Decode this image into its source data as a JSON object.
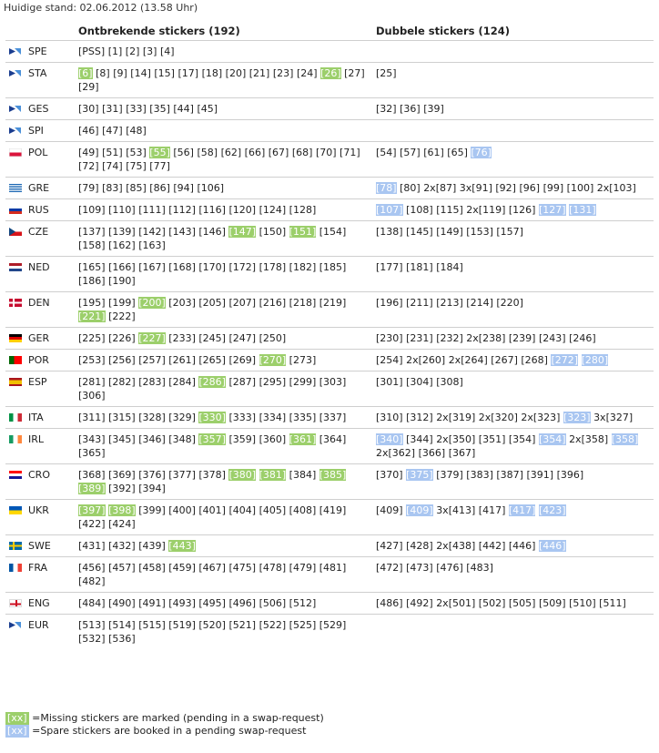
{
  "header": {
    "stand": "Huidige stand: 02.06.2012 (13.58 Uhr)"
  },
  "columns": {
    "missing": "Ontbrekende stickers (192)",
    "double": "Dubbele stickers (124)"
  },
  "flags": {
    "logo": "logo-flag",
    "POL": [
      "#ffffff",
      "#dc143c"
    ],
    "GRE": [
      "#0d5eaf",
      "#ffffff"
    ],
    "RUS": [
      "#ffffff",
      "#0039a6",
      "#d52b1e"
    ],
    "CZE": [
      "#ffffff",
      "#d7141a",
      "#11457e"
    ],
    "NED": [
      "#ae1c28",
      "#ffffff",
      "#21468b"
    ],
    "DEN": [
      "#c60c30",
      "#ffffff"
    ],
    "GER": [
      "#000000",
      "#dd0000",
      "#ffce00"
    ],
    "POR": [
      "#006600",
      "#ff0000"
    ],
    "ESP": [
      "#aa151b",
      "#f1bf00"
    ],
    "ITA": [
      "#009246",
      "#ffffff",
      "#ce2b37"
    ],
    "IRL": [
      "#169b62",
      "#ffffff",
      "#ff883e"
    ],
    "CRO": [
      "#ff0000",
      "#ffffff",
      "#171796"
    ],
    "UKR": [
      "#0057b7",
      "#ffd700"
    ],
    "SWE": [
      "#006aa7",
      "#fecc00"
    ],
    "FRA": [
      "#0055a4",
      "#ffffff",
      "#ef4135"
    ],
    "ENG": [
      "#ffffff",
      "#ce1124"
    ]
  },
  "rows": [
    {
      "code": "SPE",
      "flag": "logo",
      "missing": [
        [
          "[PSS]"
        ],
        [
          "[1]"
        ],
        [
          "[2]"
        ],
        [
          "[3]"
        ],
        [
          "[4]"
        ]
      ],
      "double": []
    },
    {
      "code": "STA",
      "flag": "logo",
      "missing": [
        [
          "[6]",
          "g"
        ],
        [
          "[8]"
        ],
        [
          "[9]"
        ],
        [
          "[14]"
        ],
        [
          "[15]"
        ],
        [
          "[17]"
        ],
        [
          "[18]"
        ],
        [
          "[20]"
        ],
        [
          "[21]"
        ],
        [
          "[23]"
        ],
        [
          "[24]"
        ],
        [
          "[26]",
          "g"
        ],
        [
          "[27]"
        ],
        [
          "[29]"
        ]
      ],
      "double": [
        [
          "[25]"
        ]
      ]
    },
    {
      "code": "GES",
      "flag": "logo",
      "missing": [
        [
          "[30]"
        ],
        [
          "[31]"
        ],
        [
          "[33]"
        ],
        [
          "[35]"
        ],
        [
          "[44]"
        ],
        [
          "[45]"
        ]
      ],
      "double": [
        [
          "[32]"
        ],
        [
          "[36]"
        ],
        [
          "[39]"
        ]
      ]
    },
    {
      "code": "SPI",
      "flag": "logo",
      "missing": [
        [
          "[46]"
        ],
        [
          "[47]"
        ],
        [
          "[48]"
        ]
      ],
      "double": []
    },
    {
      "code": "POL",
      "flag": "POL",
      "missing": [
        [
          "[49]"
        ],
        [
          "[51]"
        ],
        [
          "[53]"
        ],
        [
          "[55]",
          "g"
        ],
        [
          "[56]"
        ],
        [
          "[58]"
        ],
        [
          "[62]"
        ],
        [
          "[66]"
        ],
        [
          "[67]"
        ],
        [
          "[68]"
        ],
        [
          "[70]"
        ],
        [
          "[71]"
        ],
        [
          "[72]"
        ],
        [
          "[74]"
        ],
        [
          "[75]"
        ],
        [
          "[77]"
        ]
      ],
      "double": [
        [
          "[54]"
        ],
        [
          "[57]"
        ],
        [
          "[61]"
        ],
        [
          "[65]"
        ],
        [
          "[76]",
          "b"
        ]
      ]
    },
    {
      "code": "GRE",
      "flag": "GRE",
      "missing": [
        [
          "[79]"
        ],
        [
          "[83]"
        ],
        [
          "[85]"
        ],
        [
          "[86]"
        ],
        [
          "[94]"
        ],
        [
          "[106]"
        ]
      ],
      "double": [
        [
          "[78]",
          "b"
        ],
        [
          "[80]"
        ],
        [
          "2x[87]"
        ],
        [
          "3x[91]"
        ],
        [
          "[92]"
        ],
        [
          "[96]"
        ],
        [
          "[99]"
        ],
        [
          "[100]"
        ],
        [
          "2x[103]"
        ]
      ]
    },
    {
      "code": "RUS",
      "flag": "RUS",
      "missing": [
        [
          "[109]"
        ],
        [
          "[110]"
        ],
        [
          "[111]"
        ],
        [
          "[112]"
        ],
        [
          "[116]"
        ],
        [
          "[120]"
        ],
        [
          "[124]"
        ],
        [
          "[128]"
        ]
      ],
      "double": [
        [
          "[107]",
          "b"
        ],
        [
          "[108]"
        ],
        [
          "[115]"
        ],
        [
          "2x[119]"
        ],
        [
          "[126]"
        ],
        [
          "[127]",
          "b"
        ],
        [
          "[131]",
          "b"
        ]
      ]
    },
    {
      "code": "CZE",
      "flag": "CZE",
      "missing": [
        [
          "[137]"
        ],
        [
          "[139]"
        ],
        [
          "[142]"
        ],
        [
          "[143]"
        ],
        [
          "[146]"
        ],
        [
          "[147]",
          "g"
        ],
        [
          "[150]"
        ],
        [
          "[151]",
          "g"
        ],
        [
          "[154]"
        ],
        [
          "[158]"
        ],
        [
          "[162]"
        ],
        [
          "[163]"
        ]
      ],
      "double": [
        [
          "[138]"
        ],
        [
          "[145]"
        ],
        [
          "[149]"
        ],
        [
          "[153]"
        ],
        [
          "[157]"
        ]
      ]
    },
    {
      "code": "NED",
      "flag": "NED",
      "missing": [
        [
          "[165]"
        ],
        [
          "[166]"
        ],
        [
          "[167]"
        ],
        [
          "[168]"
        ],
        [
          "[170]"
        ],
        [
          "[172]"
        ],
        [
          "[178]"
        ],
        [
          "[182]"
        ],
        [
          "[185]"
        ],
        [
          "[186]"
        ],
        [
          "[190]"
        ]
      ],
      "double": [
        [
          "[177]"
        ],
        [
          "[181]"
        ],
        [
          "[184]"
        ]
      ]
    },
    {
      "code": "DEN",
      "flag": "DEN",
      "missing": [
        [
          "[195]"
        ],
        [
          "[199]"
        ],
        [
          "[200]",
          "g"
        ],
        [
          "[203]"
        ],
        [
          "[205]"
        ],
        [
          "[207]"
        ],
        [
          "[216]"
        ],
        [
          "[218]"
        ],
        [
          "[219]"
        ],
        [
          "[221]",
          "g"
        ],
        [
          "[222]"
        ]
      ],
      "double": [
        [
          "[196]"
        ],
        [
          "[211]"
        ],
        [
          "[213]"
        ],
        [
          "[214]"
        ],
        [
          "[220]"
        ]
      ]
    },
    {
      "code": "GER",
      "flag": "GER",
      "missing": [
        [
          "[225]"
        ],
        [
          "[226]"
        ],
        [
          "[227]",
          "g"
        ],
        [
          "[233]"
        ],
        [
          "[245]"
        ],
        [
          "[247]"
        ],
        [
          "[250]"
        ]
      ],
      "double": [
        [
          "[230]"
        ],
        [
          "[231]"
        ],
        [
          "[232]"
        ],
        [
          "2x[238]"
        ],
        [
          "[239]"
        ],
        [
          "[243]"
        ],
        [
          "[246]"
        ]
      ]
    },
    {
      "code": "POR",
      "flag": "POR",
      "missing": [
        [
          "[253]"
        ],
        [
          "[256]"
        ],
        [
          "[257]"
        ],
        [
          "[261]"
        ],
        [
          "[265]"
        ],
        [
          "[269]"
        ],
        [
          "[270]",
          "g"
        ],
        [
          "[273]"
        ]
      ],
      "double": [
        [
          "[254]"
        ],
        [
          "2x[260]"
        ],
        [
          "2x[264]"
        ],
        [
          "[267]"
        ],
        [
          "[268]"
        ],
        [
          "[272]",
          "b"
        ],
        [
          "[280]",
          "b"
        ]
      ]
    },
    {
      "code": "ESP",
      "flag": "ESP",
      "missing": [
        [
          "[281]"
        ],
        [
          "[282]"
        ],
        [
          "[283]"
        ],
        [
          "[284]"
        ],
        [
          "[286]",
          "g"
        ],
        [
          "[287]"
        ],
        [
          "[295]"
        ],
        [
          "[299]"
        ],
        [
          "[303]"
        ],
        [
          "[306]"
        ]
      ],
      "double": [
        [
          "[301]"
        ],
        [
          "[304]"
        ],
        [
          "[308]"
        ]
      ]
    },
    {
      "code": "ITA",
      "flag": "ITA",
      "missing": [
        [
          "[311]"
        ],
        [
          "[315]"
        ],
        [
          "[328]"
        ],
        [
          "[329]"
        ],
        [
          "[330]",
          "g"
        ],
        [
          "[333]"
        ],
        [
          "[334]"
        ],
        [
          "[335]"
        ],
        [
          "[337]"
        ]
      ],
      "double": [
        [
          "[310]"
        ],
        [
          "[312]"
        ],
        [
          "2x[319]"
        ],
        [
          "2x[320]"
        ],
        [
          "2x[323]"
        ],
        [
          "[323]",
          "b"
        ],
        [
          "3x[327]"
        ]
      ]
    },
    {
      "code": "IRL",
      "flag": "IRL",
      "missing": [
        [
          "[343]"
        ],
        [
          "[345]"
        ],
        [
          "[346]"
        ],
        [
          "[348]"
        ],
        [
          "[357]",
          "g"
        ],
        [
          "[359]"
        ],
        [
          "[360]"
        ],
        [
          "[361]",
          "g"
        ],
        [
          "[364]"
        ],
        [
          "[365]"
        ]
      ],
      "double": [
        [
          "[340]",
          "b"
        ],
        [
          "[344]"
        ],
        [
          "2x[350]"
        ],
        [
          "[351]"
        ],
        [
          "[354]"
        ],
        [
          "[354]",
          "b"
        ],
        [
          "2x[358]"
        ],
        [
          "[358]",
          "b"
        ],
        [
          "2x[362]"
        ],
        [
          "[366]"
        ],
        [
          "[367]"
        ]
      ]
    },
    {
      "code": "CRO",
      "flag": "CRO",
      "missing": [
        [
          "[368]"
        ],
        [
          "[369]"
        ],
        [
          "[376]"
        ],
        [
          "[377]"
        ],
        [
          "[378]"
        ],
        [
          "[380]",
          "g"
        ],
        [
          "[381]",
          "g"
        ],
        [
          "[384]"
        ],
        [
          "[385]",
          "g"
        ],
        [
          "[389]",
          "g"
        ],
        [
          "[392]"
        ],
        [
          "[394]"
        ]
      ],
      "double": [
        [
          "[370]"
        ],
        [
          "[375]",
          "b"
        ],
        [
          "[379]"
        ],
        [
          "[383]"
        ],
        [
          "[387]"
        ],
        [
          "[391]"
        ],
        [
          "[396]"
        ]
      ]
    },
    {
      "code": "UKR",
      "flag": "UKR",
      "missing": [
        [
          "[397]",
          "g"
        ],
        [
          "[398]",
          "g"
        ],
        [
          "[399]"
        ],
        [
          "[400]"
        ],
        [
          "[401]"
        ],
        [
          "[404]"
        ],
        [
          "[405]"
        ],
        [
          "[408]"
        ],
        [
          "[419]"
        ],
        [
          "[422]"
        ],
        [
          "[424]"
        ]
      ],
      "double": [
        [
          "[409]"
        ],
        [
          "[409]",
          "b"
        ],
        [
          "3x[413]"
        ],
        [
          "[417]"
        ],
        [
          "[417]",
          "b"
        ],
        [
          "[423]",
          "b"
        ]
      ]
    },
    {
      "code": "SWE",
      "flag": "SWE",
      "missing": [
        [
          "[431]"
        ],
        [
          "[432]"
        ],
        [
          "[439]"
        ],
        [
          "[443]",
          "g"
        ]
      ],
      "double": [
        [
          "[427]"
        ],
        [
          "[428]"
        ],
        [
          "2x[438]"
        ],
        [
          "[442]"
        ],
        [
          "[446]"
        ],
        [
          "[446]",
          "b"
        ]
      ]
    },
    {
      "code": "FRA",
      "flag": "FRA",
      "missing": [
        [
          "[456]"
        ],
        [
          "[457]"
        ],
        [
          "[458]"
        ],
        [
          "[459]"
        ],
        [
          "[467]"
        ],
        [
          "[475]"
        ],
        [
          "[478]"
        ],
        [
          "[479]"
        ],
        [
          "[481]"
        ],
        [
          "[482]"
        ]
      ],
      "double": [
        [
          "[472]"
        ],
        [
          "[473]"
        ],
        [
          "[476]"
        ],
        [
          "[483]"
        ]
      ]
    },
    {
      "code": "ENG",
      "flag": "ENG",
      "missing": [
        [
          "[484]"
        ],
        [
          "[490]"
        ],
        [
          "[491]"
        ],
        [
          "[493]"
        ],
        [
          "[495]"
        ],
        [
          "[496]"
        ],
        [
          "[506]"
        ],
        [
          "[512]"
        ]
      ],
      "double": [
        [
          "[486]"
        ],
        [
          "[492]"
        ],
        [
          "2x[501]"
        ],
        [
          "[502]"
        ],
        [
          "[505]"
        ],
        [
          "[509]"
        ],
        [
          "[510]"
        ],
        [
          "[511]"
        ]
      ]
    },
    {
      "code": "EUR",
      "flag": "logo",
      "missing": [
        [
          "[513]"
        ],
        [
          "[514]"
        ],
        [
          "[515]"
        ],
        [
          "[519]"
        ],
        [
          "[520]"
        ],
        [
          "[521]"
        ],
        [
          "[522]"
        ],
        [
          "[525]"
        ],
        [
          "[529]"
        ],
        [
          "[532]"
        ],
        [
          "[536]"
        ]
      ],
      "double": []
    }
  ],
  "legend": {
    "missing_swatch": "[xx]",
    "missing_text": " =Missing stickers are marked (pending in a swap-request)",
    "spare_swatch": "[xx]",
    "spare_text": " =Spare stickers are booked in a pending swap-request"
  },
  "colors": {
    "missing_highlight": "#9ccf6b",
    "spare_highlight": "#a9c6f1"
  }
}
